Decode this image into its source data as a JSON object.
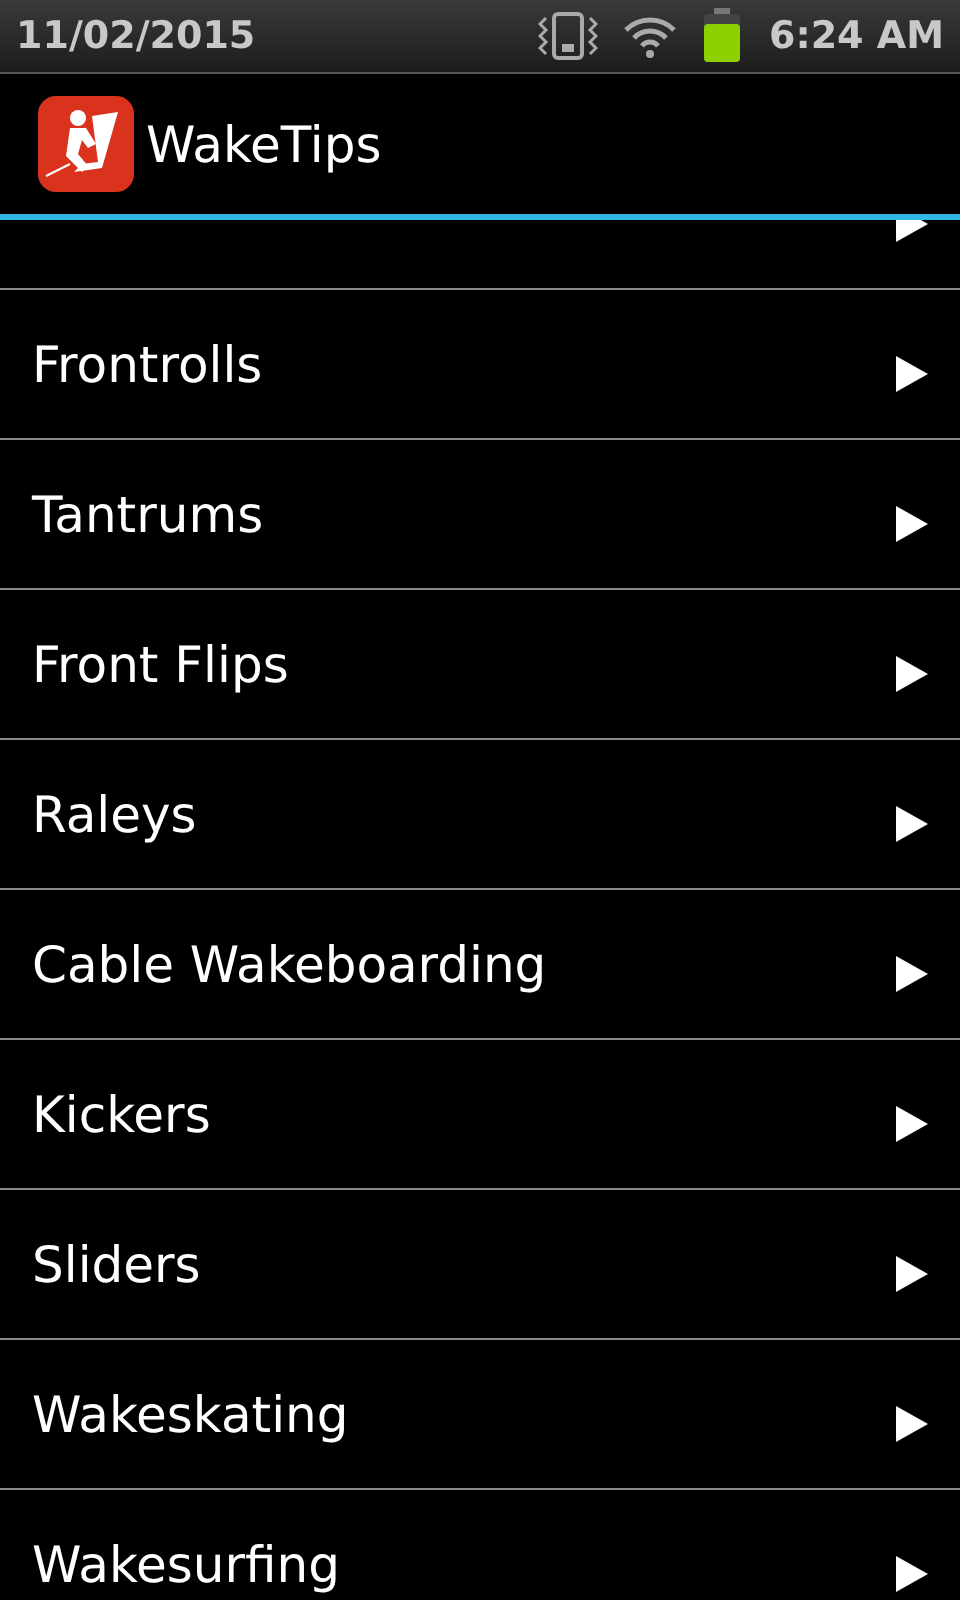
{
  "status_bar": {
    "date": "11/02/2015",
    "time": "6:24 AM"
  },
  "action_bar": {
    "title": "WakeTips"
  },
  "items": [
    {
      "label": "Frontrolls"
    },
    {
      "label": "Tantrums"
    },
    {
      "label": "Front Flips"
    },
    {
      "label": "Raleys"
    },
    {
      "label": "Cable Wakeboarding"
    },
    {
      "label": "Kickers"
    },
    {
      "label": "Sliders"
    },
    {
      "label": "Wakeskating"
    },
    {
      "label": "Wakesurfing"
    }
  ]
}
